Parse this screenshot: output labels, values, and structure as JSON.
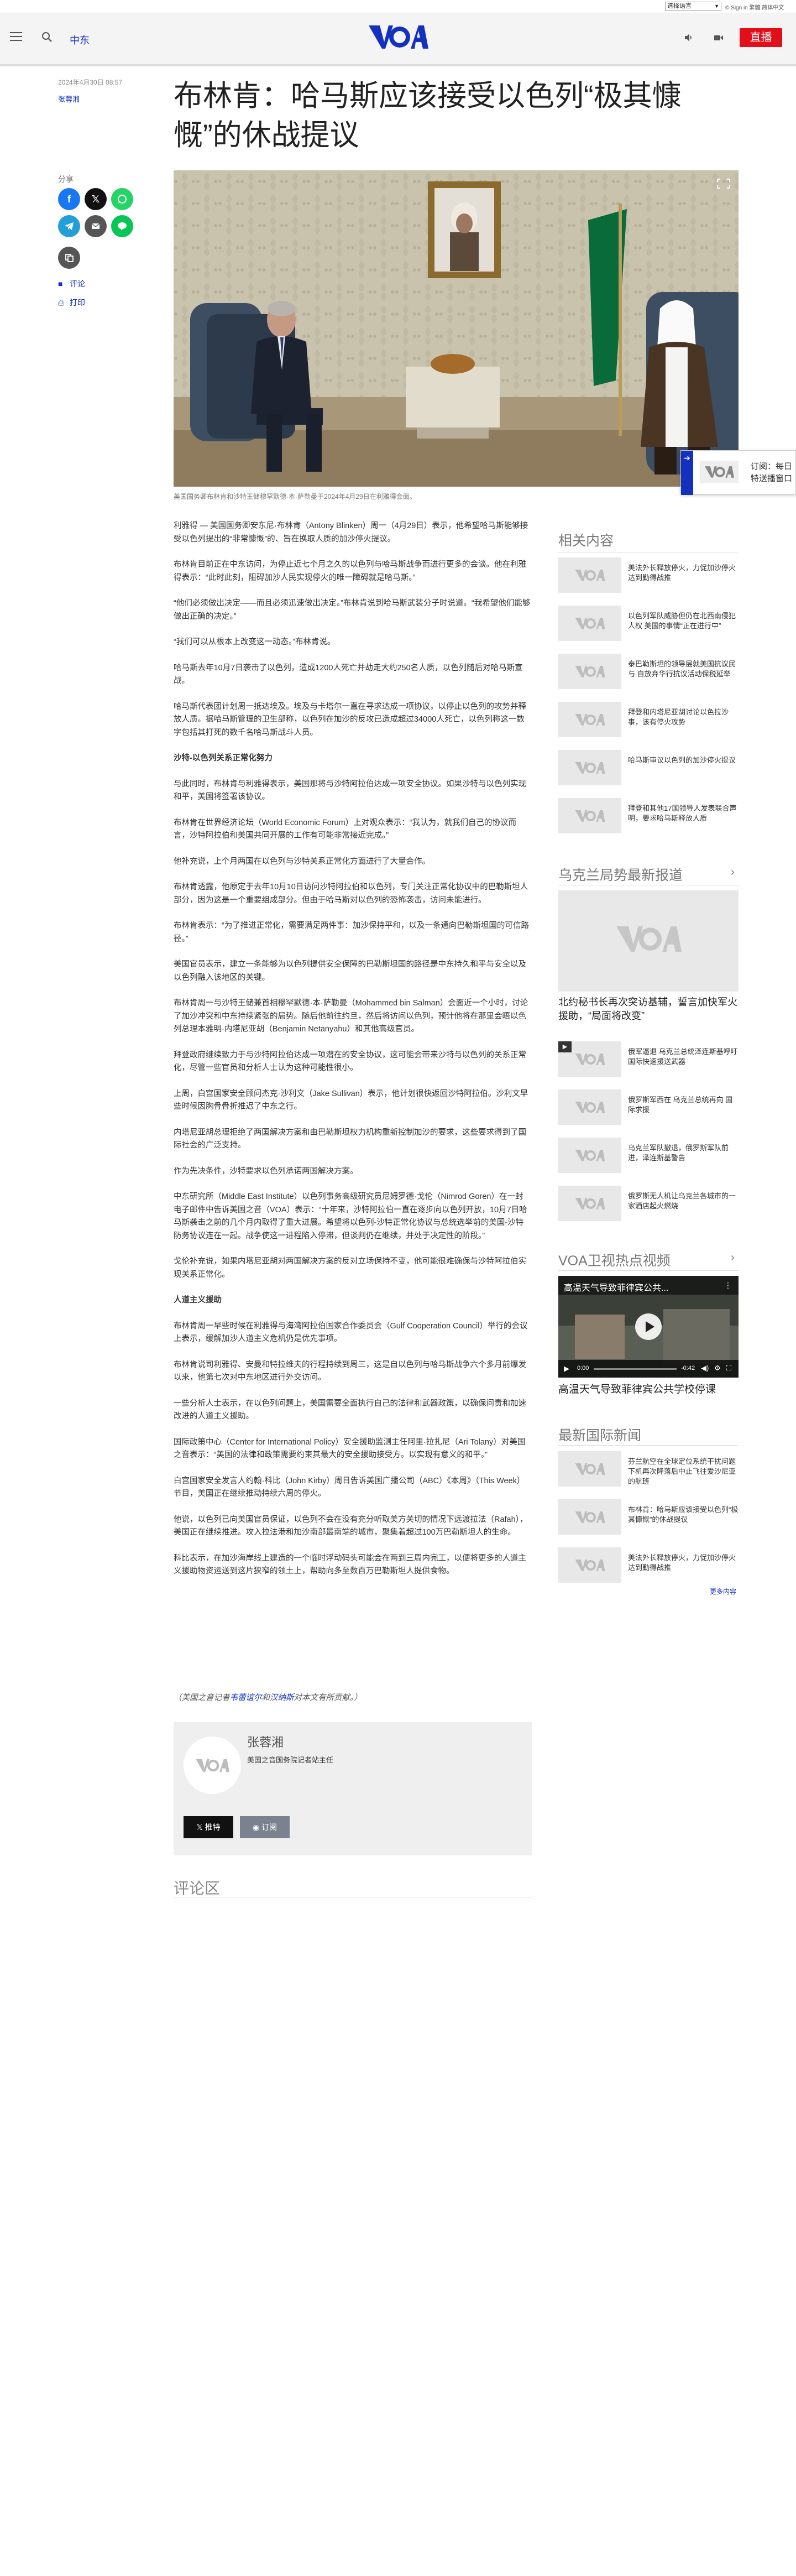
{
  "utility": {
    "language": "选择语言",
    "links": "© Sign in 繁體 简体中文"
  },
  "header": {
    "section": "中东",
    "live_label": "直播",
    "logo_alt": "VOA"
  },
  "article": {
    "dates": "2024年4月30日 08:57",
    "byline": "张蓉湘",
    "updated": "2024年4月30日 08:57",
    "title": "布林肯：哈马斯应该接受以色列“极其慷慨”的休战提议",
    "image_caption": "美国国务卿布林肯和沙特王储穆罕默德·本·萨勒曼于2024年4月29日在利雅得会面。",
    "body": [
      {
        "type": "p",
        "text": "利雅得 — 美国国务卿安东尼·布林肯（Antony Blinken）周一（4月29日）表示，他希望哈马斯能够接受以色列提出的“非常慷慨”的、旨在换取人质的加沙停火提议。"
      },
      {
        "type": "p",
        "text": "布林肯目前正在中东访问，为停止近七个月之久的以色列与哈马斯战争而进行更多的会谈。他在利雅得表示：“此时此刻，阻碍加沙人民实现停火的唯一障碍就是哈马斯。”"
      },
      {
        "type": "p",
        "text": "“他们必须做出决定——而且必须迅速做出决定。”布林肯说到哈马斯武装分子时说道。“我希望他们能够做出正确的决定。”"
      },
      {
        "type": "p",
        "text": "“我们可以从根本上改变这一动态。”布林肯说。"
      },
      {
        "type": "p",
        "text": "哈马斯去年10月7日袭击了以色列，造成1200人死亡并劫走大约250名人质，以色列随后对哈马斯宣战。"
      },
      {
        "type": "p",
        "text": "哈马斯代表团计划周一抵达埃及。埃及与卡塔尔一直在寻求达成一项协议，以停止以色列的攻势并释放人质。据哈马斯管理的卫生部称，以色列在加沙的反攻已造成超过34000人死亡，以色列称这一数字包括其打死的数千名哈马斯战斗人员。"
      },
      {
        "type": "sub",
        "text": "沙特-以色列关系正常化努力"
      },
      {
        "type": "p",
        "text": "与此同时，布林肯与利雅得表示，美国那将与沙特阿拉伯达成一项安全协议。如果沙特与以色列实现和平，美国将签署该协议。"
      },
      {
        "type": "p",
        "text": "布林肯在世界经济论坛（World Economic Forum）上对观众表示：“我认为，就我们自己的协议而言，沙特阿拉伯和美国共同开展的工作有可能非常接近完成。”"
      },
      {
        "type": "p",
        "text": "他补充说，上个月两国在以色列与沙特关系正常化方面进行了大量合作。"
      },
      {
        "type": "p",
        "text": "布林肯透露，他原定于去年10月10日访问沙特阿拉伯和以色列，专门关注正常化协议中的巴勒斯坦人部分，因为这是一个重要组成部分。但由于哈马斯对以色列的恐怖袭击，访问未能进行。"
      },
      {
        "type": "p",
        "text": "布林肯表示：“为了推进正常化，需要满足两件事：加沙保持平和，以及一条通向巴勒斯坦国的可信路径。”"
      },
      {
        "type": "p",
        "text": "美国官员表示，建立一条能够为以色列提供安全保障的巴勒斯坦国的路径是中东持久和平与安全以及以色列融入该地区的关键。"
      },
      {
        "type": "p",
        "text": "布林肯周一与沙特王储兼首相穆罕默德·本·萨勒曼（Mohammed bin Salman）会面近一个小时，讨论了加沙冲突和中东持续紧张的局势。随后他前往约旦，然后将访问以色列，预计他将在那里会晤以色列总理本雅明·内塔尼亚胡（Benjamin Netanyahu）和其他高级官员。"
      },
      {
        "type": "p",
        "text": "拜登政府继续致力于与沙特阿拉伯达成一项潜在的安全协议，这可能会带来沙特与以色列的关系正常化，尽管一些官员和分析人士认为这种可能性很小。"
      },
      {
        "type": "p",
        "text": "上周，白宫国家安全顾问杰克·沙利文（Jake Sullivan）表示，他计划很快返回沙特阿拉伯。沙利文早些时候因胸骨骨折推迟了中东之行。"
      },
      {
        "type": "p",
        "text": "内塔尼亚胡总理拒绝了两国解决方案和由巴勒斯坦权力机构重新控制加沙的要求，这些要求得到了国际社会的广泛支持。"
      },
      {
        "type": "p",
        "text": "作为先决条件，沙特要求以色列承诺两国解决方案。"
      },
      {
        "type": "p",
        "text": "中东研究所（Middle East Institute）以色列事务高级研究员尼姆罗德·戈伦（Nimrod Goren）在一封电子邮件中告诉美国之音（VOA）表示：“十年来，沙特阿拉伯一直在逐步向以色列开放，10月7日哈马斯袭击之前的几个月内取得了重大进展。希望将以色列-沙特正常化协议与总统选举前的美国-沙特防务协议连在一起。战争使这一进程陷入停滞，但谈判仍在继续，并处于决定性的阶段。”"
      },
      {
        "type": "p",
        "text": "戈伦补充说，如果内塔尼亚胡对两国解决方案的反对立场保持不变，他可能很难确保与沙特阿拉伯实现关系正常化。"
      },
      {
        "type": "sub",
        "text": "人道主义援助"
      },
      {
        "type": "p",
        "text": "布林肯周一早些时候在利雅得与海湾阿拉伯国家合作委员会（Gulf Cooperation Council）举行的会议上表示，缓解加沙人道主义危机仍是优先事项。"
      },
      {
        "type": "p",
        "text": "布林肯说司利雅得、安曼和特拉维夫的行程持续到周三，这是自以色列与哈马斯战争六个多月前爆发以来，他第七次对中东地区进行外交访问。"
      },
      {
        "type": "p",
        "text": "一些分析人士表示，在以色列问题上，美国需要全面执行自己的法律和武器政策，以确保问责和加速改进的人道主义援助。"
      },
      {
        "type": "p",
        "text": "国际政策中心（Center for International Policy）安全援助监测主任阿里·拉扎尼（Ari Tolany）对美国之音表示：“美国的法律和政策需要约束其最大的安全援助接受方。以实现有意义的和平。”"
      },
      {
        "type": "p",
        "text": "白宫国家安全发言人约翰·科比（John Kirby）周日告诉美国广播公司（ABC）《本周》（This Week）节目，美国正在继续推动持续六周的停火。"
      },
      {
        "type": "p",
        "text": "他说，以色列已向美国官员保证，以色列不会在没有充分听取美方关切的情况下远渡拉法（Rafah），美国正在继续推进。攻入拉法港和加沙南部最南端的城市，聚集着超过100万巴勒斯坦人的生命。"
      },
      {
        "type": "p",
        "text": "科比表示，在加沙海岸线上建造的一个临时浮动码头可能会在两到三周内完工，以便将更多的人道主义援助物资运送到这片狭窄的领土上，帮助向多至数百万巴勒斯坦人提供食物。"
      }
    ],
    "credit_prefix": "（美国之音记者",
    "credit_name1": "韦蕾谊尔",
    "credit_mid": "和",
    "credit_name2": "汉纳斯",
    "credit_suffix": "对本文有所贡献。）"
  },
  "share": {
    "label": "分享",
    "comment": "评论",
    "print": "打印"
  },
  "author_box": {
    "name": "张蓉湘",
    "role": "美国之音国务院记者站主任",
    "follow": "𝕏  推特",
    "subscribe": "订阅"
  },
  "comments_title": "评论区",
  "related": {
    "title": "相关内容",
    "items": [
      "美法外长释放停火，力促加沙停火达到勤得战推",
      "以色列军队威胁但仍在北西南侵犯人权 美国的事情“正在进行中”",
      "泰巴勒斯坦的领导层就美国抗议民与 自放弃华行抗议活动保税延举",
      "拜登和内塔尼亚胡讨论以色拉沙事，该有停火攻势",
      "哈马斯审议以色列的加沙停火提议",
      "拜登和其他17国领导人发表联合声明，要求哈马斯释放人质"
    ]
  },
  "ukraine": {
    "title": "乌克兰局势最新报道",
    "headline": "北约秘书长再次突访基辅，誓言加快军火援助，“局面将改变”",
    "items": [
      "俄军逼退 乌克兰总统泽连斯基呼吁国际快速援送武器",
      "俄罗斯军西在 乌克兰总统再向 国际求援",
      "乌克兰军队撤退，俄罗斯军队前进，泽连斯基警告",
      "俄罗斯无人机让乌克兰各城市的一家酒店起火燃烧"
    ]
  },
  "video": {
    "title": "VOA卫视热点视频",
    "clip_title": "高温天气导致菲律宾公共...",
    "caption": "高温天气导致菲律宾公共学校停课",
    "time_current": "0:00",
    "time_total": "-0:42"
  },
  "latest": {
    "title": "最新国际新闻",
    "items": [
      "芬兰航空在全球定位系统干扰问题下机再次降落后中止飞往爱沙尼亚的航班",
      "布林肯：哈马斯应该接受以色列“极其慷慨”的休战提议",
      "美法外长释放停火，力促加沙停火达到勤得战推"
    ],
    "more": "更多内容"
  },
  "promo": {
    "text_line1": "订阅：每日",
    "text_line2": "特送播窗口"
  }
}
